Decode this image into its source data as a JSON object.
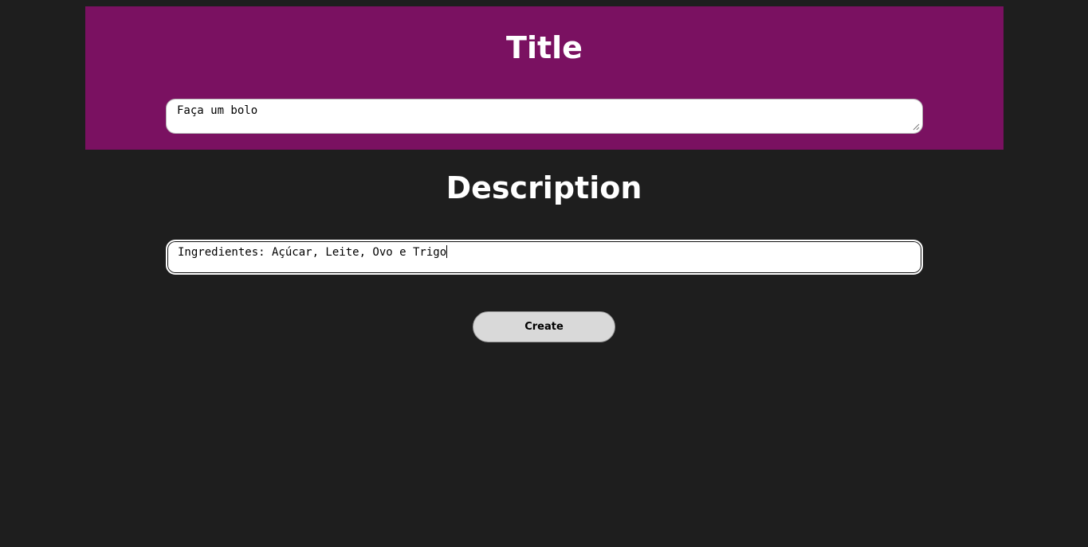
{
  "title_section": {
    "heading": "Title",
    "input_value": "Faça um bolo",
    "background_color": "#7a1161"
  },
  "description_section": {
    "heading": "Description",
    "input_value": "Ingredientes: Açúcar, Leite, Ovo e Trigo"
  },
  "actions": {
    "create_label": "Create"
  },
  "colors": {
    "page_background": "#1e1e1e",
    "button_background": "#d9d9d9"
  }
}
